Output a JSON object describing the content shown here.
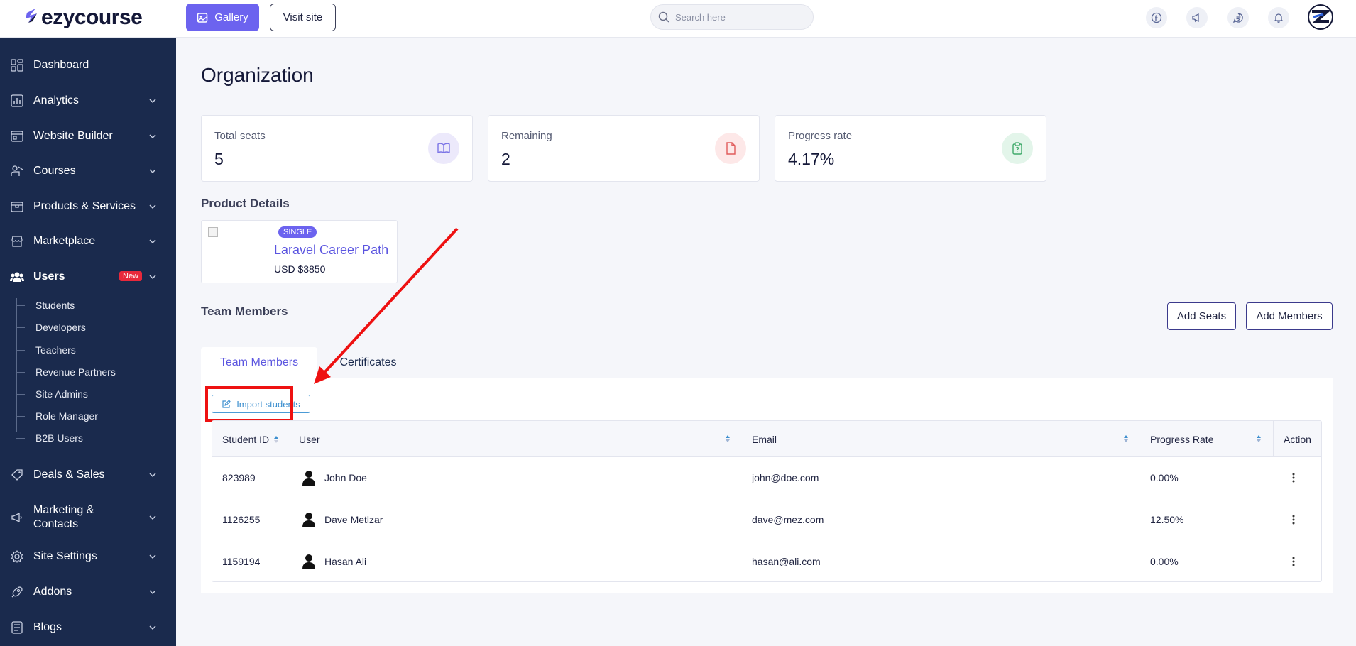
{
  "brand": {
    "logo_text": "ezycourse"
  },
  "header": {
    "gallery_label": "Gallery",
    "visit_label": "Visit site",
    "search_placeholder": "Search here"
  },
  "sidebar": {
    "items": [
      {
        "label": "Dashboard",
        "icon": "dashboard-icon"
      },
      {
        "label": "Analytics",
        "icon": "analytics-icon"
      },
      {
        "label": "Website Builder",
        "icon": "website-builder-icon"
      },
      {
        "label": "Courses",
        "icon": "courses-icon"
      },
      {
        "label": "Products & Services",
        "icon": "products-icon"
      },
      {
        "label": "Marketplace",
        "icon": "marketplace-icon"
      },
      {
        "label": "Users",
        "icon": "users-icon",
        "badge": "New"
      },
      {
        "label": "Deals & Sales",
        "icon": "deals-icon"
      },
      {
        "label": "Marketing & Contacts",
        "icon": "marketing-icon"
      },
      {
        "label": "Site Settings",
        "icon": "settings-icon"
      },
      {
        "label": "Addons",
        "icon": "addons-icon"
      },
      {
        "label": "Blogs",
        "icon": "blogs-icon"
      }
    ],
    "users_sub": [
      "Students",
      "Developers",
      "Teachers",
      "Revenue Partners",
      "Site Admins",
      "Role Manager",
      "B2B Users"
    ]
  },
  "main": {
    "title": "Organization",
    "stats": [
      {
        "label": "Total seats",
        "value": "5",
        "icon": "book-icon",
        "color": "#ece9fb"
      },
      {
        "label": "Remaining",
        "value": "2",
        "icon": "file-icon",
        "color": "#fde8e8"
      },
      {
        "label": "Progress rate",
        "value": "4.17%",
        "icon": "clipboard-icon",
        "color": "#e3f5ea"
      }
    ],
    "product_section_title": "Product Details",
    "product": {
      "badge": "SINGLE",
      "name": "Laravel Career Path",
      "price": "USD $3850"
    },
    "team_section_title": "Team Members",
    "add_seats_label": "Add Seats",
    "add_members_label": "Add Members",
    "tabs": [
      {
        "label": "Team Members",
        "active": true
      },
      {
        "label": "Certificates",
        "active": false
      }
    ],
    "import_label": "Import students",
    "table": {
      "headers": {
        "id": "Student ID",
        "user": "User",
        "email": "Email",
        "progress": "Progress Rate",
        "action": "Action"
      },
      "rows": [
        {
          "id": "823989",
          "user": "John Doe",
          "email": "john@doe.com",
          "progress": "0.00%"
        },
        {
          "id": "1126255",
          "user": "Dave Metlzar",
          "email": "dave@mez.com",
          "progress": "12.50%"
        },
        {
          "id": "1159194",
          "user": "Hasan Ali",
          "email": "hasan@ali.com",
          "progress": "0.00%"
        }
      ]
    }
  },
  "colors": {
    "accent": "#6c63ef",
    "sidebar_bg": "#1a2a4d",
    "highlight": "#ee1111",
    "link_blue": "#3d8fcf"
  }
}
